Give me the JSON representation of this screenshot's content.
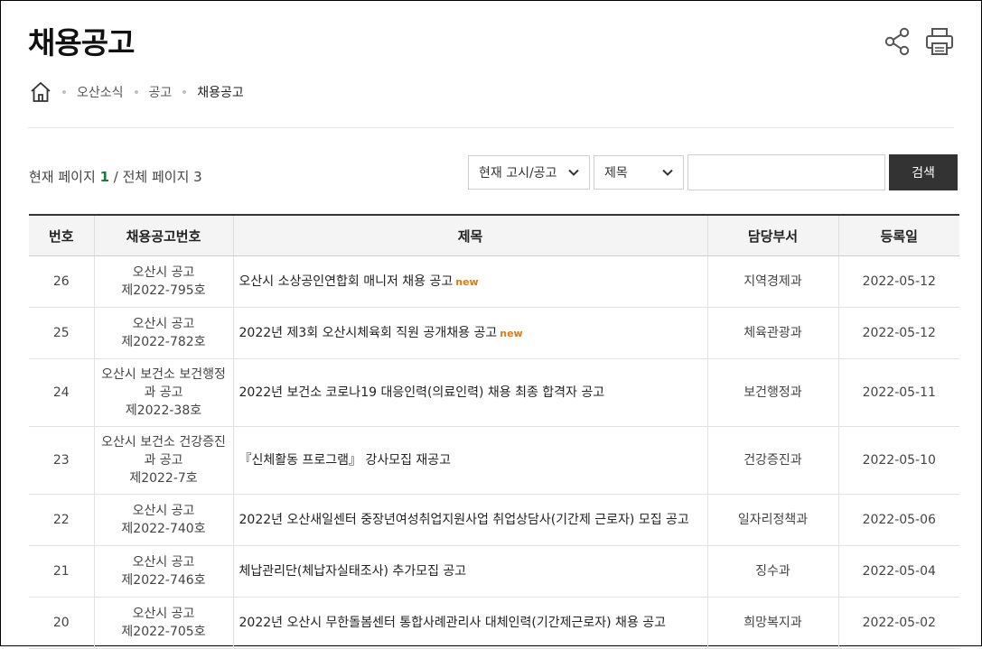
{
  "page": {
    "title": "채용공고"
  },
  "breadcrumb": {
    "items": [
      "오산소식",
      "공고"
    ],
    "current": "채용공고"
  },
  "pageinfo": {
    "prefix": "현재 페이지",
    "current": "1",
    "sep": "/ 전체 페이지",
    "total": "3"
  },
  "search": {
    "category_value": "현재 고시/공고",
    "field_value": "제목",
    "keyword_value": "",
    "button_label": "검색"
  },
  "table": {
    "headers": {
      "no": "번호",
      "notice_no": "채용공고번호",
      "title": "제목",
      "dept": "담당부서",
      "date": "등록일"
    },
    "rows": [
      {
        "no": "26",
        "notice_no": "오산시 공고\n제2022-795호",
        "title": "오산시 소상공인연합회 매니저 채용 공고",
        "is_new": "new",
        "dept": "지역경제과",
        "date": "2022-05-12"
      },
      {
        "no": "25",
        "notice_no": "오산시 공고\n제2022-782호",
        "title": "2022년 제3회 오산시체육회 직원 공개채용 공고",
        "is_new": "new",
        "dept": "체육관광과",
        "date": "2022-05-12"
      },
      {
        "no": "24",
        "notice_no": "오산시 보건소 보건행정\n과 공고\n제2022-38호",
        "title": "2022년 보건소 코로나19 대응인력(의료인력) 채용 최종 합격자 공고",
        "is_new": "",
        "dept": "보건행정과",
        "date": "2022-05-11"
      },
      {
        "no": "23",
        "notice_no": "오산시 보건소 건강증진\n과 공고\n제2022-7호",
        "title": "『신체활동 프로그램』 강사모집 재공고",
        "is_new": "",
        "dept": "건강증진과",
        "date": "2022-05-10"
      },
      {
        "no": "22",
        "notice_no": "오산시 공고\n제2022-740호",
        "title": "2022년 오산새일센터 중장년여성취업지원사업 취업상담사(기간제 근로자) 모집 공고",
        "is_new": "",
        "dept": "일자리정책과",
        "date": "2022-05-06"
      },
      {
        "no": "21",
        "notice_no": "오산시 공고\n제2022-746호",
        "title": "체납관리단(체납자실태조사) 추가모집 공고",
        "is_new": "",
        "dept": "징수과",
        "date": "2022-05-04"
      },
      {
        "no": "20",
        "notice_no": "오산시 공고\n제2022-705호",
        "title": "2022년 오산시 무한돌봄센터 통합사례관리사 대체인력(기간제근로자) 채용 공고",
        "is_new": "",
        "dept": "희망복지과",
        "date": "2022-05-02"
      }
    ]
  },
  "icons": {
    "share": "share-icon",
    "print": "print-icon",
    "home": "home-icon",
    "chevron": "chevron-down-icon"
  },
  "colors": {
    "accent_page": "#1a7a3e",
    "new_tag": "#e07a10",
    "button_bg": "#333333"
  }
}
